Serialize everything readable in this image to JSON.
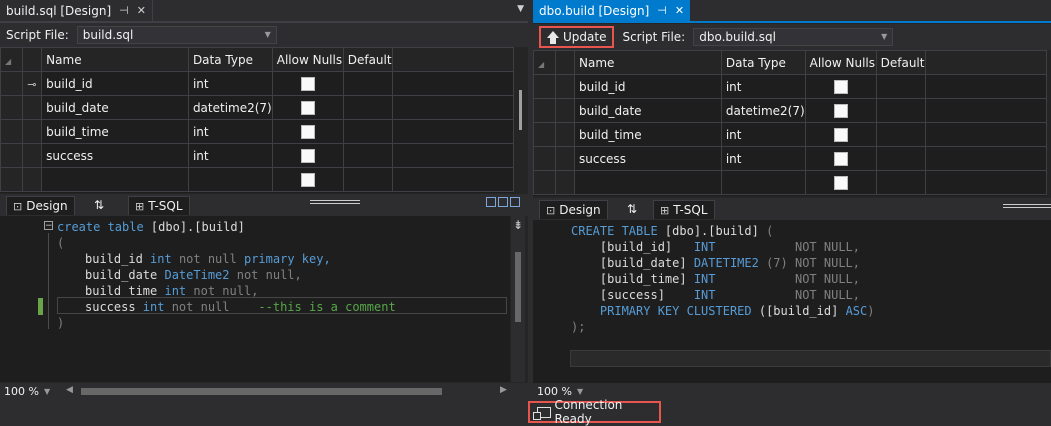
{
  "left": {
    "tab_title": "build.sql [Design]",
    "script_file_label": "Script File:",
    "script_file_value": "build.sql",
    "columns": [
      "Name",
      "Data Type",
      "Allow Nulls",
      "Default"
    ],
    "rows": [
      {
        "name": "build_id",
        "type": "int",
        "key": true
      },
      {
        "name": "build_date",
        "type": "datetime2(7)",
        "key": false
      },
      {
        "name": "build_time",
        "type": "int",
        "key": false
      },
      {
        "name": "success",
        "type": "int",
        "key": false
      },
      {
        "name": "",
        "type": "",
        "key": false
      }
    ],
    "view_tabs": {
      "design": "Design",
      "swap": "⇅",
      "tsql": "T-SQL"
    },
    "code": {
      "l1_kw": "create table ",
      "l1_tx": "[dbo].[build]",
      "l2": "(",
      "l3_a": "build_id ",
      "l3_b": "int ",
      "l3_c": "not null ",
      "l3_d": "primary key,",
      "l4_a": "build_date ",
      "l4_b": "DateTime2 ",
      "l4_c": "not null,",
      "l5_a": "build_time ",
      "l5_b": "int ",
      "l5_c": "not null,",
      "l6_a": "success ",
      "l6_b": "int ",
      "l6_c": "not null    ",
      "l6_d": "--this is a comment",
      "l7": ")"
    },
    "zoom": "100 %"
  },
  "right": {
    "tab_title": "dbo.build [Design]",
    "update_label": "Update",
    "script_file_label": "Script File:",
    "script_file_value": "dbo.build.sql",
    "columns": [
      "Name",
      "Data Type",
      "Allow Nulls",
      "Default"
    ],
    "rows": [
      {
        "name": "build_id",
        "type": "int",
        "key": false
      },
      {
        "name": "build_date",
        "type": "datetime2(7)",
        "key": false
      },
      {
        "name": "build_time",
        "type": "int",
        "key": false
      },
      {
        "name": "success",
        "type": "int",
        "key": false
      },
      {
        "name": "",
        "type": "",
        "key": false
      }
    ],
    "view_tabs": {
      "design": "Design",
      "swap": "⇅",
      "tsql": "T-SQL"
    },
    "code": {
      "l1_kw": "CREATE TABLE ",
      "l1_tx": "[dbo].[build] ",
      "l1_p": "(",
      "l2_a": "    [build_id]   ",
      "l2_b": "INT           ",
      "l2_c": "NOT NULL,",
      "l3_a": "    [build_date] ",
      "l3_b": "DATETIME2 ",
      "l3_c": "(7) ",
      "l3_d": "NOT NULL,",
      "l4_a": "    [build_time] ",
      "l4_b": "INT           ",
      "l4_c": "NOT NULL,",
      "l5_a": "    [success]    ",
      "l5_b": "INT           ",
      "l5_c": "NOT NULL,",
      "l6_a": "    ",
      "l6_b": "PRIMARY KEY CLUSTERED ",
      "l6_c": "([build_id] ",
      "l6_d": "ASC",
      "l6_e": ")",
      "l7": ");"
    },
    "zoom": "100 %"
  },
  "status": {
    "connection": "Connection Ready"
  }
}
